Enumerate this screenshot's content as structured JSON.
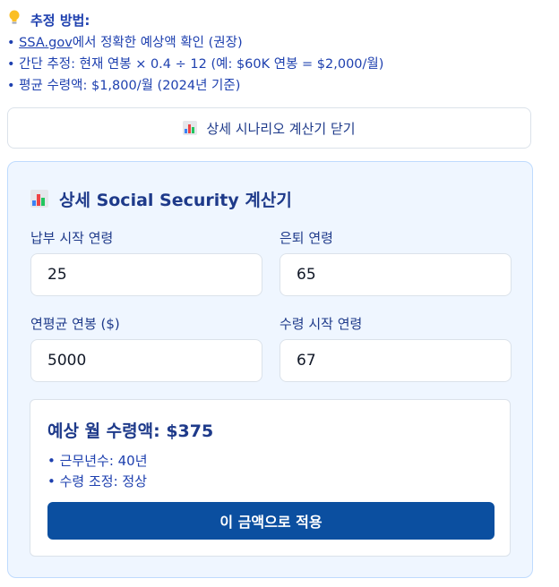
{
  "tips": {
    "icon": "lightbulb-icon",
    "title": "추정 방법:",
    "line1_bullet": "• ",
    "line1_link": "SSA.gov",
    "line1_rest": "에서 정확한 예상액 확인 (권장)",
    "line2": "• 간단 추정: 현재 연봉 × 0.4 ÷ 12 (예: $60K 연봉 = $2,000/월)",
    "line3": "• 평균 수령액: $1,800/월 (2024년 기준)"
  },
  "toggle": {
    "icon": "bar-chart-icon",
    "label": "상세 시나리오 계산기 닫기"
  },
  "calculator": {
    "icon": "bar-chart-icon",
    "title": "상세 Social Security 계산기",
    "fields": {
      "start_age_label": "납부 시작 연령",
      "start_age_value": "25",
      "retire_age_label": "은퇴 연령",
      "retire_age_value": "65",
      "avg_salary_label": "연평균 연봉 ($)",
      "avg_salary_value": "5000",
      "claim_age_label": "수령 시작 연령",
      "claim_age_value": "67"
    },
    "result": {
      "title": "예상 월 수령액: $375",
      "years_worked": "• 근무년수: 40년",
      "adjustment": "• 수령 조정: 정상",
      "apply_label": "이 금액으로 적용"
    }
  },
  "colors": {
    "accent": "#1e40af",
    "panel_bg": "#eff6ff",
    "button_bg": "#0b4fa0"
  }
}
